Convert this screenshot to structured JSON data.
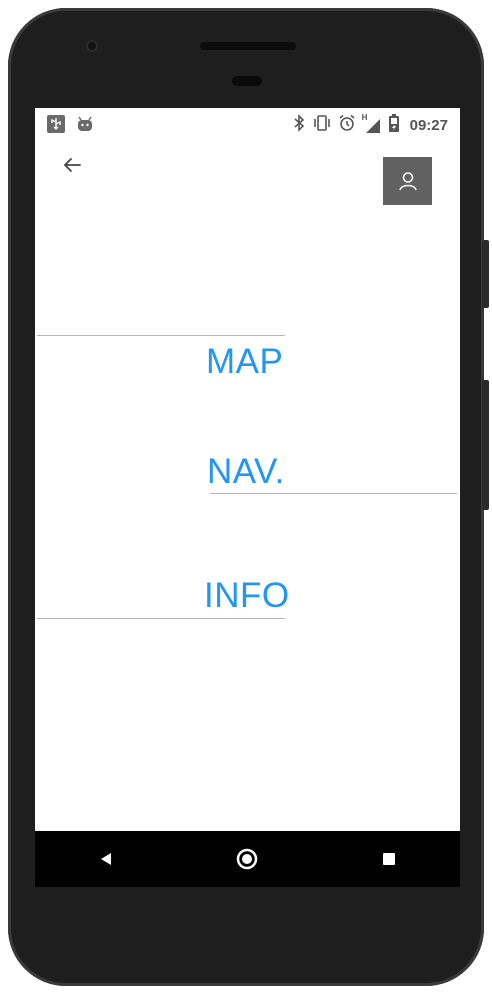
{
  "status_bar": {
    "left_icons": [
      "usb-icon",
      "android-debug-icon"
    ],
    "right_icons": [
      "bluetooth-icon",
      "vibrate-icon",
      "alarm-icon",
      "signal-icon",
      "battery-icon"
    ],
    "signal_label": "H",
    "time": "09:27"
  },
  "top_bar": {
    "back_icon": "arrow-left-icon",
    "profile_icon": "person-icon"
  },
  "menu": {
    "map_label": "MAP",
    "nav_label": "NAV.",
    "info_label": "INFO"
  },
  "nav_bar": {
    "back_icon": "triangle-back-icon",
    "home_icon": "circle-home-icon",
    "recents_icon": "square-recents-icon"
  },
  "colors": {
    "accent": "#2196f3",
    "profile_button": "#616161",
    "divider": "#b5b5b5",
    "device_body": "#1e1e1e"
  }
}
